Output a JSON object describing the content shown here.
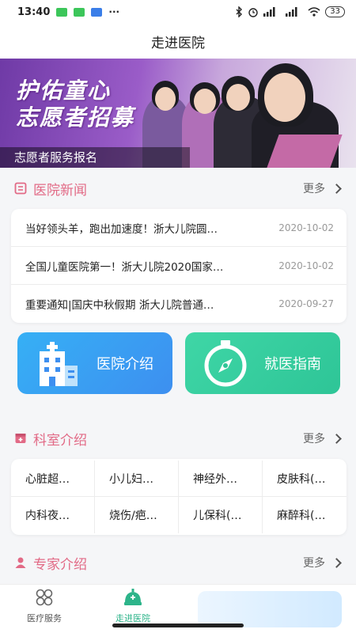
{
  "status_bar": {
    "time": "13:40",
    "dots": "···",
    "battery": "33"
  },
  "title": "走进医院",
  "banner": {
    "headline_1": "护佑童心",
    "headline_2": "志愿者招募",
    "caption": "志愿者服务报名",
    "colors": {
      "primary": "#8a4cbf"
    }
  },
  "news_section": {
    "title": "医院新闻",
    "more": "更多",
    "items": [
      {
        "title": "当好领头羊，跑出加速度！浙大儿院圆…",
        "date": "2020-10-02"
      },
      {
        "title": "全国儿童医院第一！浙大儿院2020国家…",
        "date": "2020-10-02"
      },
      {
        "title": "重要通知|国庆中秋假期 浙大儿院普通…",
        "date": "2020-09-27"
      }
    ]
  },
  "quick_buttons": {
    "intro": {
      "label": "医院介绍",
      "icon": "hospital-building-icon",
      "color": "#3b9ef3"
    },
    "guide": {
      "label": "就医指南",
      "icon": "compass-stopwatch-icon",
      "color": "#34cf9f"
    }
  },
  "dept_section": {
    "title": "科室介绍",
    "more": "更多",
    "items": [
      "心脏超…",
      "小儿妇…",
      "神经外…",
      "皮肤科(…",
      "内科夜…",
      "烧伤/疤…",
      "儿保科(…",
      "麻醉科(…"
    ]
  },
  "expert_section": {
    "title": "专家介绍",
    "more": "更多"
  },
  "bottom_nav": {
    "items": [
      {
        "label": "医疗服务",
        "icon": "grid-icon"
      },
      {
        "label": "走进医院",
        "icon": "hospital-bell-icon",
        "active": true
      }
    ]
  },
  "theme": {
    "accent_pink": "#e26a86",
    "accent_green": "#2db48a"
  }
}
